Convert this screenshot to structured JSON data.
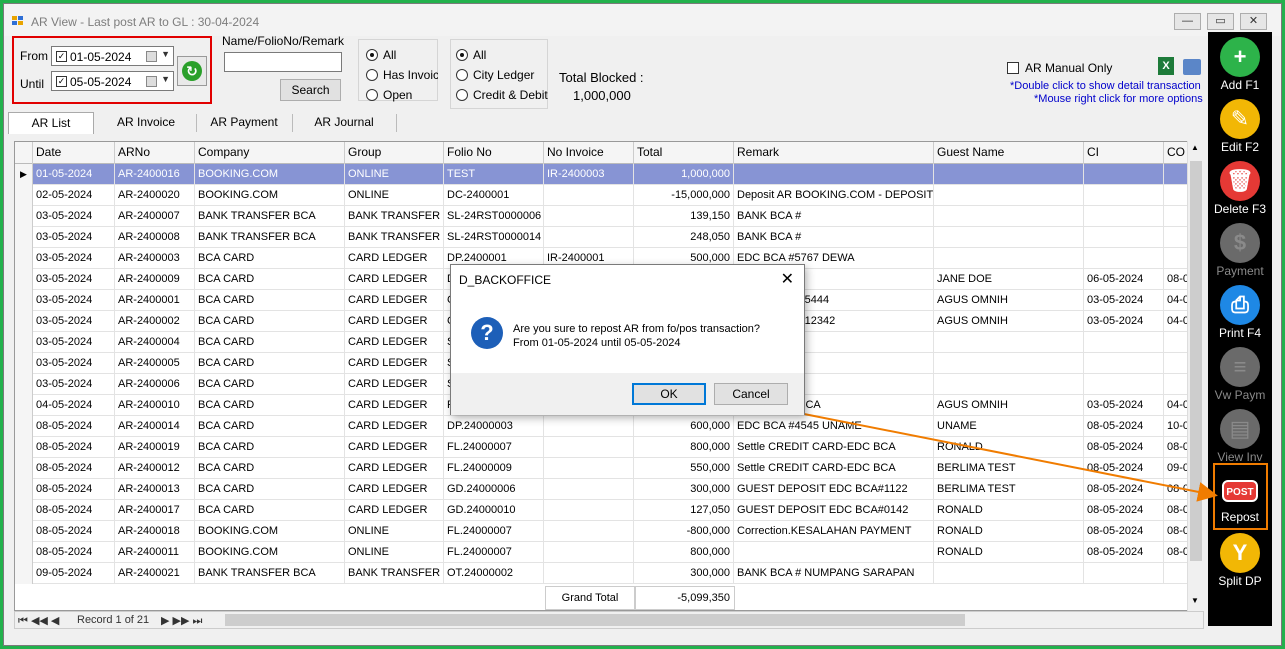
{
  "window": {
    "title": "AR View - Last post AR to GL : 30-04-2024",
    "minimize_glyph": "—",
    "maximize_glyph": "▭",
    "close_glyph": "✕"
  },
  "filters": {
    "from_label": "From",
    "from_value": "01-05-2024",
    "until_label": "Until",
    "until_value": "05-05-2024",
    "name_label": "Name/FolioNo/Remark",
    "name_value": "",
    "search_label": "Search",
    "invoice_options": [
      "All",
      "Has Invoice",
      "Open"
    ],
    "ledger_options": [
      "All",
      "City Ledger",
      "Credit & Debit"
    ],
    "total_blocked_label": "Total Blocked :",
    "total_blocked_value": "1,000,000",
    "ar_manual_label": "AR Manual Only",
    "hint1": "*Double click to show detail transaction",
    "hint2": "*Mouse right click for more options"
  },
  "tabs": [
    "AR List",
    "AR Invoice",
    "AR Payment",
    "AR Journal"
  ],
  "grid": {
    "columns": [
      "Date",
      "ARNo",
      "Company",
      "Group",
      "Folio No",
      "No Invoice",
      "Total",
      "Remark",
      "Guest Name",
      "CI",
      "CO"
    ],
    "rows": [
      [
        "01-05-2024",
        "AR-2400016",
        "BOOKING.COM",
        "ONLINE",
        "TEST",
        "IR-2400003",
        "1,000,000",
        "",
        "",
        "",
        ""
      ],
      [
        "02-05-2024",
        "AR-2400020",
        "BOOKING.COM",
        "ONLINE",
        "DC-2400001",
        "",
        "-15,000,000",
        "Deposit AR BOOKING.COM - DEPOSIT…",
        "",
        "",
        ""
      ],
      [
        "03-05-2024",
        "AR-2400007",
        "BANK TRANSFER BCA",
        "BANK TRANSFER",
        "SL-24RST0000006",
        "",
        "139,150",
        "BANK BCA #",
        "",
        "",
        ""
      ],
      [
        "03-05-2024",
        "AR-2400008",
        "BANK TRANSFER BCA",
        "BANK TRANSFER",
        "SL-24RST0000014",
        "",
        "248,050",
        "BANK BCA #",
        "",
        "",
        ""
      ],
      [
        "03-05-2024",
        "AR-2400003",
        "BCA CARD",
        "CARD LEDGER",
        "DP.2400001",
        "IR-2400001",
        "500,000",
        "EDC BCA #5767 DEWA",
        "",
        "",
        ""
      ],
      [
        "03-05-2024",
        "AR-2400009",
        "BCA CARD",
        "CARD LEDGER",
        "D",
        "",
        "",
        "34 JANE",
        "JANE DOE",
        "06-05-2024",
        "08-0"
      ],
      [
        "03-05-2024",
        "AR-2400001",
        "BCA CARD",
        "CARD LEDGER",
        "C",
        "",
        "",
        "IT EDC BCA#5444",
        "AGUS OMNIH",
        "03-05-2024",
        "04-0"
      ],
      [
        "03-05-2024",
        "AR-2400002",
        "BCA CARD",
        "CARD LEDGER",
        "C",
        "",
        "",
        "IT EDC BCA#12342",
        "AGUS OMNIH",
        "03-05-2024",
        "04-0"
      ],
      [
        "03-05-2024",
        "AR-2400004",
        "BCA CARD",
        "CARD LEDGER",
        "S",
        "",
        "",
        "",
        "",
        "",
        ""
      ],
      [
        "03-05-2024",
        "AR-2400005",
        "BCA CARD",
        "CARD LEDGER",
        "S",
        "",
        "",
        "",
        "",
        "",
        ""
      ],
      [
        "03-05-2024",
        "AR-2400006",
        "BCA CARD",
        "CARD LEDGER",
        "S",
        "",
        "",
        "",
        "",
        "",
        ""
      ],
      [
        "04-05-2024",
        "AR-2400010",
        "BCA CARD",
        "CARD LEDGER",
        "F",
        "",
        "",
        "CARD-EDC BCA",
        "AGUS OMNIH",
        "03-05-2024",
        "04-0"
      ],
      [
        "08-05-2024",
        "AR-2400014",
        "BCA CARD",
        "CARD LEDGER",
        "DP.24000003",
        "",
        "600,000",
        "EDC BCA #4545 UNAME",
        "UNAME",
        "08-05-2024",
        "10-0"
      ],
      [
        "08-05-2024",
        "AR-2400019",
        "BCA CARD",
        "CARD LEDGER",
        "FL.24000007",
        "",
        "800,000",
        "Settle CREDIT CARD-EDC BCA",
        "RONALD",
        "08-05-2024",
        "08-0"
      ],
      [
        "08-05-2024",
        "AR-2400012",
        "BCA CARD",
        "CARD LEDGER",
        "FL.24000009",
        "",
        "550,000",
        "Settle CREDIT CARD-EDC BCA",
        "BERLIMA TEST",
        "08-05-2024",
        "09-0"
      ],
      [
        "08-05-2024",
        "AR-2400013",
        "BCA CARD",
        "CARD LEDGER",
        "GD.24000006",
        "",
        "300,000",
        "GUEST DEPOSIT EDC BCA#1122",
        "BERLIMA TEST",
        "08-05-2024",
        "08-0"
      ],
      [
        "08-05-2024",
        "AR-2400017",
        "BCA CARD",
        "CARD LEDGER",
        "GD.24000010",
        "",
        "127,050",
        "GUEST DEPOSIT EDC BCA#0142",
        "RONALD",
        "08-05-2024",
        "08-0"
      ],
      [
        "08-05-2024",
        "AR-2400018",
        "BOOKING.COM",
        "ONLINE",
        "FL.24000007",
        "",
        "-800,000",
        "Correction.KESALAHAN PAYMENT",
        "RONALD",
        "08-05-2024",
        "08-0"
      ],
      [
        "08-05-2024",
        "AR-2400011",
        "BOOKING.COM",
        "ONLINE",
        "FL.24000007",
        "",
        "800,000",
        "",
        "RONALD",
        "08-05-2024",
        "08-0"
      ],
      [
        "09-05-2024",
        "AR-2400021",
        "BANK TRANSFER BCA",
        "BANK TRANSFER",
        "OT.24000002",
        "",
        "300,000",
        "BANK BCA # NUMPANG SARAPAN",
        "",
        "",
        ""
      ]
    ],
    "grand_total_label": "Grand Total",
    "grand_total_value": "-5,099,350",
    "record_label": "Record 1 of 21"
  },
  "sidebar": [
    {
      "label": "Add F1",
      "icon": "plus-icon",
      "glyph": "+",
      "color": "#2db34a",
      "enabled": true
    },
    {
      "label": "Edit F2",
      "icon": "edit-icon",
      "glyph": "✎",
      "color": "#f2b705",
      "enabled": true
    },
    {
      "label": "Delete F3",
      "icon": "trash-icon",
      "glyph": "🗑",
      "color": "#e53935",
      "enabled": true
    },
    {
      "label": "Payment",
      "icon": "payment-icon",
      "glyph": "$",
      "color": "#6a6a6a",
      "enabled": false
    },
    {
      "label": "Print F4",
      "icon": "printer-icon",
      "glyph": "⎙",
      "color": "#1e88e5",
      "enabled": true
    },
    {
      "label": "Vw Paym",
      "icon": "receipt-icon",
      "glyph": "≡",
      "color": "#6a6a6a",
      "enabled": false
    },
    {
      "label": "View Inv",
      "icon": "invoice-icon",
      "glyph": "▤",
      "color": "#6a6a6a",
      "enabled": false
    },
    {
      "label": "Repost",
      "icon": "post-icon",
      "glyph": "POST",
      "color": "#e53935",
      "enabled": true
    },
    {
      "label": "Split DP",
      "icon": "split-icon",
      "glyph": "Y",
      "color": "#f2b705",
      "enabled": true
    }
  ],
  "dialog": {
    "title": "D_BACKOFFICE",
    "line1": "Are you sure to repost AR from fo/pos transaction?",
    "line2": "From 01-05-2024 until 05-05-2024",
    "ok_label": "OK",
    "cancel_label": "Cancel",
    "icon_glyph": "?",
    "close_glyph": "✕"
  },
  "colors": {
    "accent_red": "#e10000",
    "arrow_orange": "#f07c00",
    "selected_row": "#8794d4",
    "hint_blue": "#0000cc"
  }
}
